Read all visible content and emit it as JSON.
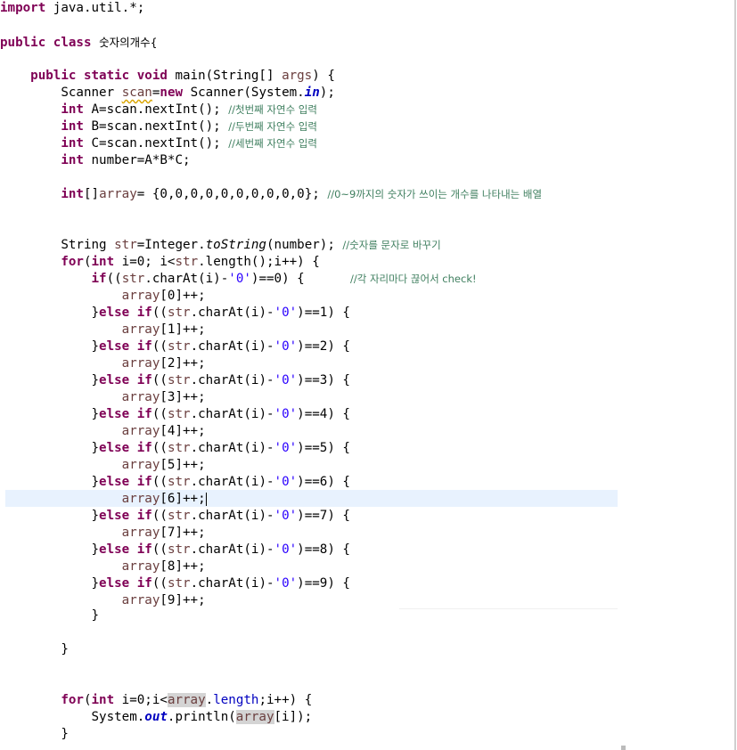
{
  "code": {
    "l1_kw": "import",
    "l1_rest": " java.util.*;",
    "l2_kw1": "public",
    "l2_kw2": "class",
    "l2_name": "숫자의개수{",
    "l3_kw1": "public",
    "l3_kw2": "static",
    "l3_kw3": "void",
    "l3_rest1": " main(String[] ",
    "l3_args": "args",
    "l3_rest2": ") {",
    "scanner_a": "Scanner ",
    "scanner_var": "scan",
    "scanner_b": "=",
    "scanner_new": "new",
    "scanner_c": " Scanner(System.",
    "scanner_in": "in",
    "scanner_d": ");",
    "int_kw": "int",
    "a_code": " A=scan.nextInt(); ",
    "a_comment": "//첫번째 자연수 입력",
    "b_code": " B=scan.nextInt(); ",
    "b_comment": "//두번째 자연수 입력",
    "c_code": " C=scan.nextInt(); ",
    "c_comment": "//세번째 자연수 입력",
    "num_code": " number=A*B*C;",
    "arr_kw": "int",
    "arr_a": "[]",
    "arr_var": "array",
    "arr_b": "= {0,0,0,0,0,0,0,0,0,0}; ",
    "arr_comment": "//0~9까지의 숫자가 쓰이는 개수를 나타내는 배열",
    "str_a": "String ",
    "str_var": "str",
    "str_b": "=Integer.",
    "str_method": "toString",
    "str_c": "(number); ",
    "str_comment": "//숫자를 문자로 바꾸기",
    "for_kw": "for",
    "for_a": "(",
    "for_int": "int",
    "for_b": " i=0; i<",
    "for_str": "str",
    "for_c": ".length();i++) {",
    "if_kw": "if",
    "if_a": "((",
    "if_str": "str",
    "if_b": ".charAt(i)-",
    "if_char": "'0'",
    "if_c": ")==0) {      ",
    "if_comment": "//각 자리마다 끊어서 check!",
    "else_kw": "else",
    "close_brace": "}",
    "for2_kw": "for",
    "for2_int": "int",
    "for2_a": " i=0;i<",
    "for2_arr": "array",
    "for2_b": ".",
    "for2_len": "length",
    "for2_c": ";i++) {",
    "println_a": "System.",
    "println_out": "out",
    "println_b": ".println(",
    "println_arr": "array",
    "println_c": "[i]);",
    "inc_lines": [
      "[0]++;",
      "[1]++;",
      "[2]++;",
      "[3]++;",
      "[4]++;",
      "[5]++;",
      "[6]++;",
      "[7]++;",
      "[8]++;",
      "[9]++;"
    ],
    "elseif_digits": [
      ")==1) {",
      ")==2) {",
      ")==3) {",
      ")==4) {",
      ")==5) {",
      ")==6) {",
      ")==7) {",
      ")==8) {",
      ")==9) {"
    ]
  }
}
